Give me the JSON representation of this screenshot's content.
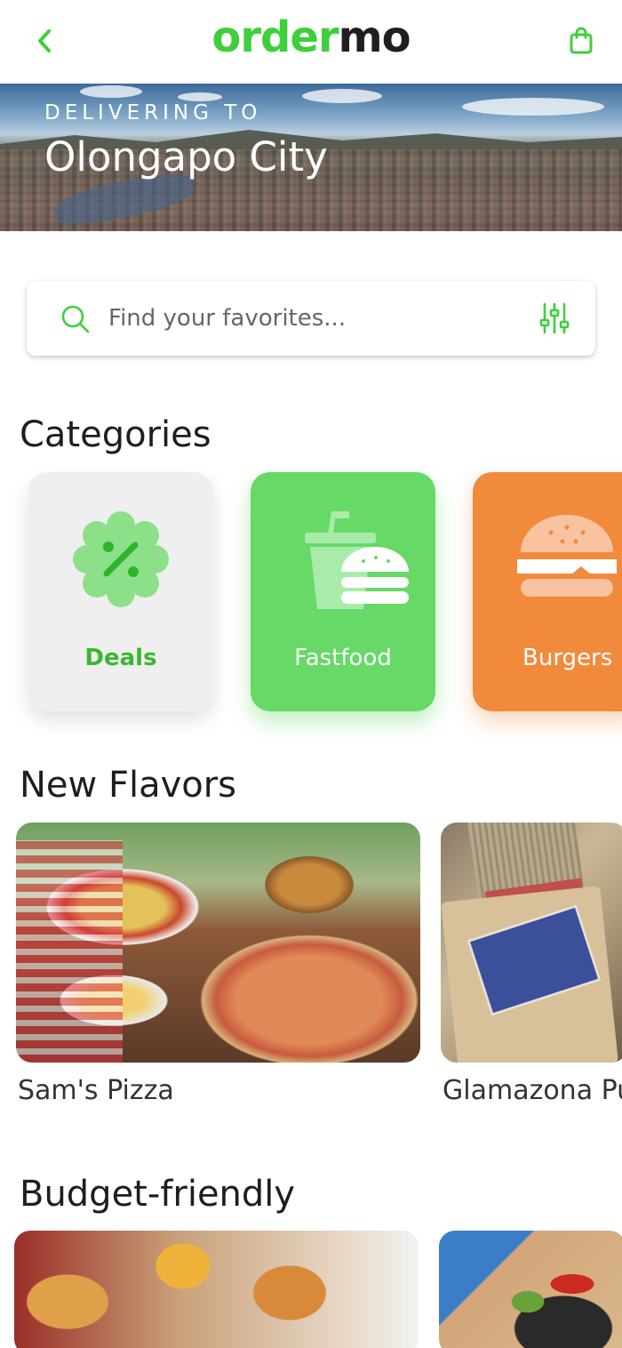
{
  "app": {
    "logo_part1": "order",
    "logo_part2": "mo"
  },
  "colors": {
    "brand_green": "#3fcf3a",
    "deals_bg": "#efefef",
    "fastfood_bg": "#66d966",
    "burgers_bg": "#f28a3c"
  },
  "hero": {
    "label": "DELIVERING TO",
    "city": "Olongapo City"
  },
  "search": {
    "placeholder": "Find your favorites..."
  },
  "sections": {
    "categories": "Categories",
    "new_flavors": "New Flavors",
    "budget_friendly": "Budget-friendly"
  },
  "categories": [
    {
      "label": "Deals",
      "icon": "discount-badge-icon"
    },
    {
      "label": "Fastfood",
      "icon": "drink-burger-icon"
    },
    {
      "label": "Burgers",
      "icon": "burger-icon"
    }
  ],
  "new_flavors": [
    {
      "name": "Sam's Pizza"
    },
    {
      "name": "Glamazona Pu"
    }
  ],
  "icons": {
    "back": "chevron-left-icon",
    "cart": "shopping-bag-icon",
    "search": "search-icon",
    "filter": "sliders-icon"
  }
}
